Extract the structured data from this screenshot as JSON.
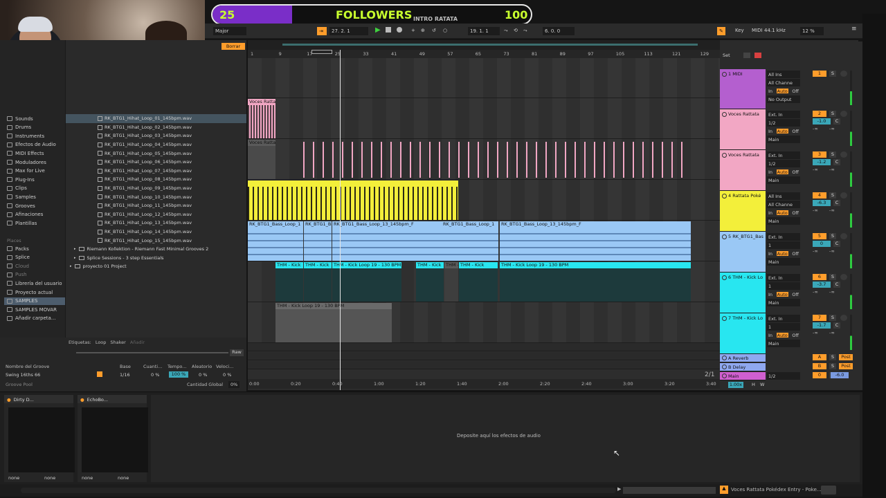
{
  "overlay": {
    "left_count": "25",
    "title": "FOLLOWERS",
    "subtitle": "INTRO RATATA",
    "right_count": "100",
    "progress": 0.25
  },
  "toolbar": {
    "scale": "Major",
    "position": "27.   2.   1",
    "loop_start": "19.   1.   1",
    "loop_length": "6.   0.   0",
    "key_label": "Key",
    "midi_label": "MIDI",
    "sample_rate": "44.1 kHz",
    "cpu": "12 %",
    "set_label": "Set"
  },
  "browser": {
    "delete_label": "Borrar",
    "categories": [
      {
        "label": "Sounds",
        "icon": "sounds-icon"
      },
      {
        "label": "Drums",
        "icon": "drums-icon"
      },
      {
        "label": "Instruments",
        "icon": "instruments-icon"
      },
      {
        "label": "Efectos de Audio",
        "icon": "audio-effects-icon"
      },
      {
        "label": "MIDI Effects",
        "icon": "midi-effects-icon"
      },
      {
        "label": "Moduladores",
        "icon": "modulators-icon"
      },
      {
        "label": "Max for Live",
        "icon": "max-for-live-icon"
      },
      {
        "label": "Plug-Ins",
        "icon": "plugins-icon"
      },
      {
        "label": "Clips",
        "icon": "clips-icon"
      },
      {
        "label": "Samples",
        "icon": "samples-icon"
      },
      {
        "label": "Grooves",
        "icon": "grooves-icon"
      },
      {
        "label": "Afinaciones",
        "icon": "tunings-icon"
      },
      {
        "label": "Plantillas",
        "icon": "templates-icon"
      }
    ],
    "places_label": "Places",
    "places": [
      {
        "label": "Packs"
      },
      {
        "label": "Splice"
      },
      {
        "label": "Cloud"
      },
      {
        "label": "Push"
      },
      {
        "label": "Librería del usuario"
      },
      {
        "label": "Proyecto actual"
      },
      {
        "label": "SAMPLES"
      },
      {
        "label": "SAMPLES MOVAR"
      },
      {
        "label": "Añadir carpeta..."
      }
    ],
    "files": [
      "RK_BTG1_Hihat_Loop_01_145bpm.wav",
      "RK_BTG1_Hihat_Loop_02_145bpm.wav",
      "RK_BTG1_Hihat_Loop_03_145bpm.wav",
      "RK_BTG1_Hihat_Loop_04_145bpm.wav",
      "RK_BTG1_Hihat_Loop_05_145bpm.wav",
      "RK_BTG1_Hihat_Loop_06_145bpm.wav",
      "RK_BTG1_Hihat_Loop_07_145bpm.wav",
      "RK_BTG1_Hihat_Loop_08_145bpm.wav",
      "RK_BTG1_Hihat_Loop_09_145bpm.wav",
      "RK_BTG1_Hihat_Loop_10_145bpm.wav",
      "RK_BTG1_Hihat_Loop_11_145bpm.wav",
      "RK_BTG1_Hihat_Loop_12_145bpm.wav",
      "RK_BTG1_Hihat_Loop_13_145bpm.wav",
      "RK_BTG1_Hihat_Loop_14_145bpm.wav",
      "RK_BTG1_Hihat_Loop_15_145bpm.wav"
    ],
    "folders": [
      "Riemann Kollektion - Riemann Fast Minimal Grooves 2",
      "Splice Sessions - 3 step Essentials",
      "proyecto 01  Project"
    ],
    "tags_label": "Etiquetas:",
    "tags": [
      "Loop",
      "Shaker"
    ],
    "tag_add": "Añadir",
    "raw_label": "Raw"
  },
  "groove": {
    "col_name": "Nombre del Groove",
    "col_base": "Base",
    "col_quant": "Cuanti...",
    "col_tempo": "Tempo...",
    "col_random": "Aleatorio",
    "col_vel": "Veloci...",
    "row_name": "Swing 16ths 66",
    "row_base": "1/16",
    "row_quant": "0 %",
    "row_tempo": "100 %",
    "row_random": "0 %",
    "row_vel": "0 %",
    "pool_label": "Groove Pool",
    "global_label": "Cantidad Global",
    "global_value": "0%"
  },
  "arrangement": {
    "bars": [
      "1",
      "9",
      "17",
      "25",
      "33",
      "41",
      "49",
      "57",
      "65",
      "73",
      "81",
      "89",
      "97",
      "105",
      "113",
      "121",
      "129"
    ],
    "times": [
      "0:00",
      "0:20",
      "0:40",
      "1:00",
      "1:20",
      "1:40",
      "2:00",
      "2:20",
      "2:40",
      "3:00",
      "3:20",
      "3:40"
    ],
    "zoom_ratio": "2/1",
    "clip_voces": "Voces Rattata",
    "clip_bass": "RK_BTG1_Bass_Loop_13_145bpm_F",
    "clip_bass_short": "RK_BTG1_Bass_Loop_1",
    "clip_kick": "THM - Kick Loop 19 - 130 BPM",
    "clip_kick_short": "THM - Kick"
  },
  "mixer": {
    "tracks": [
      {
        "name": "1 MIDI",
        "color": "#b45fcf",
        "in1": "All Ins",
        "in2": "All Channe",
        "out": "No Output",
        "num": "1",
        "vol": ""
      },
      {
        "name": "Voces Rattata",
        "color": "#f2a7c4",
        "in1": "Ext. In",
        "in2": "1/2",
        "out": "Main",
        "num": "2",
        "vol": "-1.0"
      },
      {
        "name": "Voces Rattata",
        "color": "#f2a7c4",
        "in1": "Ext. In",
        "in2": "1/2",
        "out": "Main",
        "num": "3",
        "vol": "-1.2"
      },
      {
        "name": "4 Rattata Poké",
        "color": "#f3ef3a",
        "in1": "All Ins",
        "in2": "All Channe",
        "out": "Main",
        "num": "4",
        "vol": "-6.3"
      },
      {
        "name": "5 RK_BTG1_Bas",
        "color": "#9ac8f5",
        "in1": "Ext. In",
        "in2": "1",
        "out": "Main",
        "num": "5",
        "vol": "0"
      },
      {
        "name": "6 THM - Kick Lo",
        "color": "#28e6f0",
        "in1": "Ext. In",
        "in2": "1",
        "out": "Main",
        "num": "6",
        "vol": "-3.7"
      },
      {
        "name": "7 THM - Kick Lo",
        "color": "#28e6f0",
        "in1": "Ext. In",
        "in2": "1",
        "out": "Main",
        "num": "7",
        "vol": "-1.7"
      }
    ],
    "returns": [
      {
        "name": "A Reverb",
        "color": "#8fa8f0",
        "num": "A",
        "post": "Post"
      },
      {
        "name": "B Delay",
        "color": "#8fa8f0",
        "num": "B",
        "post": "Post"
      },
      {
        "name": "Main",
        "color": "#d05fd0",
        "num": "0",
        "out": "1/2",
        "vol": "-6.0"
      }
    ],
    "auto_label": "Auto",
    "in_label": "In",
    "off_label": "Off",
    "solo_label": "S",
    "center_label": "C",
    "minus_inf": "-∞",
    "tempo_mult": "1.00x",
    "h_label": "H",
    "w_label": "W"
  },
  "devices": {
    "dev1": "Dirty D...",
    "dev2": "EchoBo...",
    "none": "none",
    "drop_hint": "Deposite aquí los efectos de audio"
  },
  "status": {
    "clip_name": "Voces Rattata Pokédex Entry - Poke..."
  },
  "colors": {
    "accent": "#ff9d2b",
    "overlay_fill": "#7a2ec8",
    "overlay_text": "#c8ff2e"
  }
}
